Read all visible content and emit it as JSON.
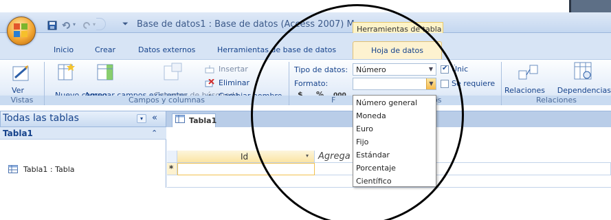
{
  "window": {
    "title": "Base de datos1 : Base de datos (Access 2007) M",
    "contextual_tab": "Herramientas de tabla"
  },
  "ribbon_tabs": [
    "Inicio",
    "Crear",
    "Datos externos",
    "Herramientas de base de datos",
    "Hoja de datos"
  ],
  "ribbon": {
    "vistas": {
      "ver_label": "Ver",
      "group": "Vistas"
    },
    "campos": {
      "nuevo_campo": "Nuevo campo",
      "agregar_campos": "Agregar campos existentes",
      "columna_busqueda": "Columna de búsqueda",
      "insertar": "Insertar",
      "eliminar": "Eliminar",
      "cambiar_nombre": "Cambiar nombre",
      "group": "Campos y columnas"
    },
    "tipo": {
      "tipo_label": "Tipo de datos:",
      "tipo_value": "Número",
      "formato_label": "Formato:",
      "currency_btn": "$",
      "percent_btn": "%",
      "thousands_btn": "000",
      "unico_label": "Únic",
      "se_requiere_label": "Se requiere",
      "group_partial_left": "F",
      "group_partial_right": "os"
    },
    "relaciones": {
      "relaciones": "Relaciones",
      "dependencias": "Dependencias del objeto",
      "group": "Relaciones"
    }
  },
  "format_dropdown": {
    "options": [
      "Número general",
      "Moneda",
      "Euro",
      "Fijo",
      "Estándar",
      "Porcentaje",
      "Científico"
    ]
  },
  "nav_pane": {
    "title": "Todas las tablas",
    "group": "Tabla1",
    "items": [
      "Tabla1 : Tabla"
    ]
  },
  "document": {
    "tab": "Tabla1",
    "columns": [
      "Id",
      "Agrega"
    ],
    "new_row_marker": "*"
  },
  "colors": {
    "ribbon_blue": "#d7e4f5",
    "text_blue": "#15428b",
    "active_tab": "#fdf2d0",
    "office_orange": "#f2a531"
  }
}
